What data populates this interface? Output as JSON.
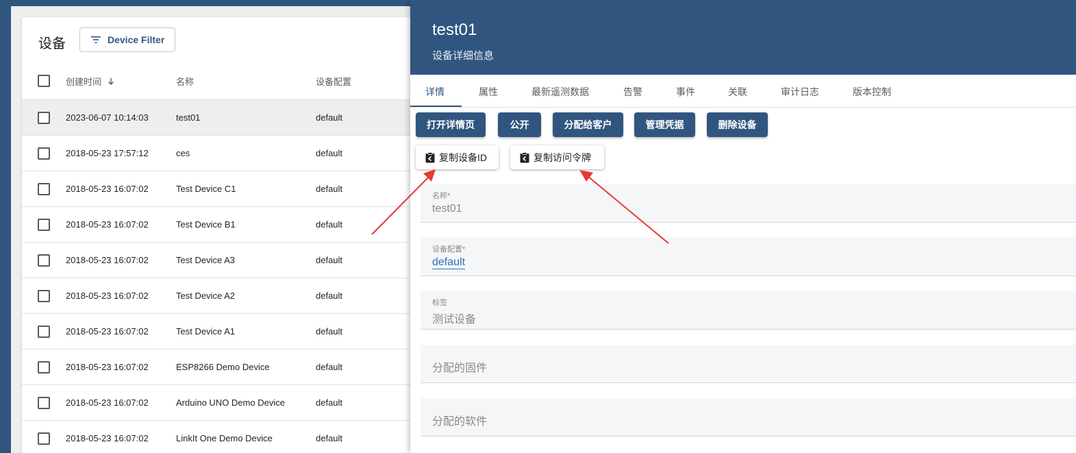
{
  "list": {
    "title": "设备",
    "filter_label": "Device Filter",
    "columns": {
      "created": "创建时间",
      "name": "名称",
      "profile": "设备配置"
    },
    "rows": [
      {
        "created": "2023-06-07 10:14:03",
        "name": "test01",
        "profile": "default",
        "selected": true
      },
      {
        "created": "2018-05-23 17:57:12",
        "name": "ces",
        "profile": "default"
      },
      {
        "created": "2018-05-23 16:07:02",
        "name": "Test Device C1",
        "profile": "default"
      },
      {
        "created": "2018-05-23 16:07:02",
        "name": "Test Device B1",
        "profile": "default"
      },
      {
        "created": "2018-05-23 16:07:02",
        "name": "Test Device A3",
        "profile": "default"
      },
      {
        "created": "2018-05-23 16:07:02",
        "name": "Test Device A2",
        "profile": "default"
      },
      {
        "created": "2018-05-23 16:07:02",
        "name": "Test Device A1",
        "profile": "default"
      },
      {
        "created": "2018-05-23 16:07:02",
        "name": "ESP8266 Demo Device",
        "profile": "default"
      },
      {
        "created": "2018-05-23 16:07:02",
        "name": "Arduino UNO Demo Device",
        "profile": "default"
      },
      {
        "created": "2018-05-23 16:07:02",
        "name": "LinkIt One Demo Device",
        "profile": "default"
      }
    ]
  },
  "drawer": {
    "title": "test01",
    "subtitle": "设备详细信息",
    "tabs": [
      "详情",
      "属性",
      "最新遥测数据",
      "告警",
      "事件",
      "关联",
      "审计日志",
      "版本控制"
    ],
    "actions": [
      "打开详情页",
      "公开",
      "分配给客户",
      "管理凭据",
      "删除设备"
    ],
    "copy_buttons": [
      "复制设备ID",
      "复制访问令牌"
    ],
    "fields": {
      "name": {
        "label": "名称*",
        "value": "test01"
      },
      "profile": {
        "label": "设备配置*",
        "value": "default"
      },
      "label": {
        "label": "标签",
        "value": "测试设备"
      },
      "firmware": {
        "placeholder": "分配的固件"
      },
      "software": {
        "placeholder": "分配的软件"
      }
    }
  },
  "colors": {
    "primary": "#305680",
    "arrow": "#e53935",
    "link": "#2e71b8"
  },
  "icons": [
    "filter-icon",
    "sort-down-icon",
    "clipboard-icon"
  ]
}
